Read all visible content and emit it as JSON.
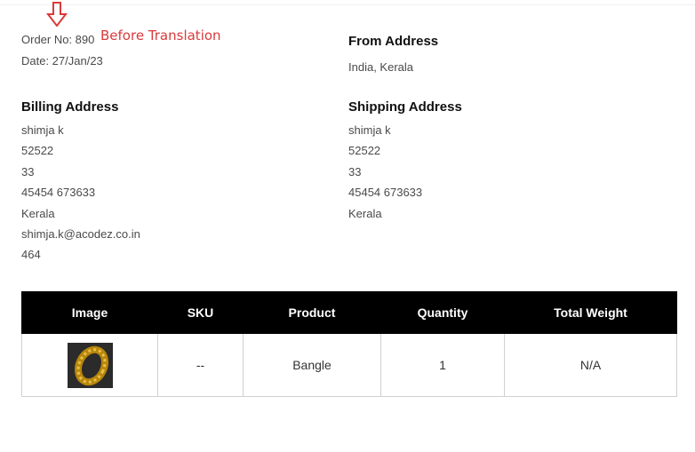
{
  "annotation": {
    "label": "Before Translation",
    "arrow_icon": "down-arrow-icon",
    "color": "#d93a3a"
  },
  "order": {
    "number_line": "Order No: 890",
    "date_line": "Date: 27/Jan/23"
  },
  "from_address": {
    "heading": "From Address",
    "value": "India, Kerala"
  },
  "billing_address": {
    "heading": "Billing Address",
    "lines": [
      "shimja k",
      "52522",
      "33",
      "45454 673633",
      "Kerala",
      "shimja.k@acodez.co.in",
      "464"
    ]
  },
  "shipping_address": {
    "heading": "Shipping Address",
    "lines": [
      "shimja k",
      "52522",
      "33",
      "45454 673633",
      "Kerala"
    ]
  },
  "table": {
    "headers": [
      "Image",
      "SKU",
      "Product",
      "Quantity",
      "Total Weight"
    ],
    "rows": [
      {
        "image": "gold-ring-product-image",
        "sku": "--",
        "product": "Bangle",
        "quantity": "1",
        "total_weight": "N/A"
      }
    ]
  }
}
